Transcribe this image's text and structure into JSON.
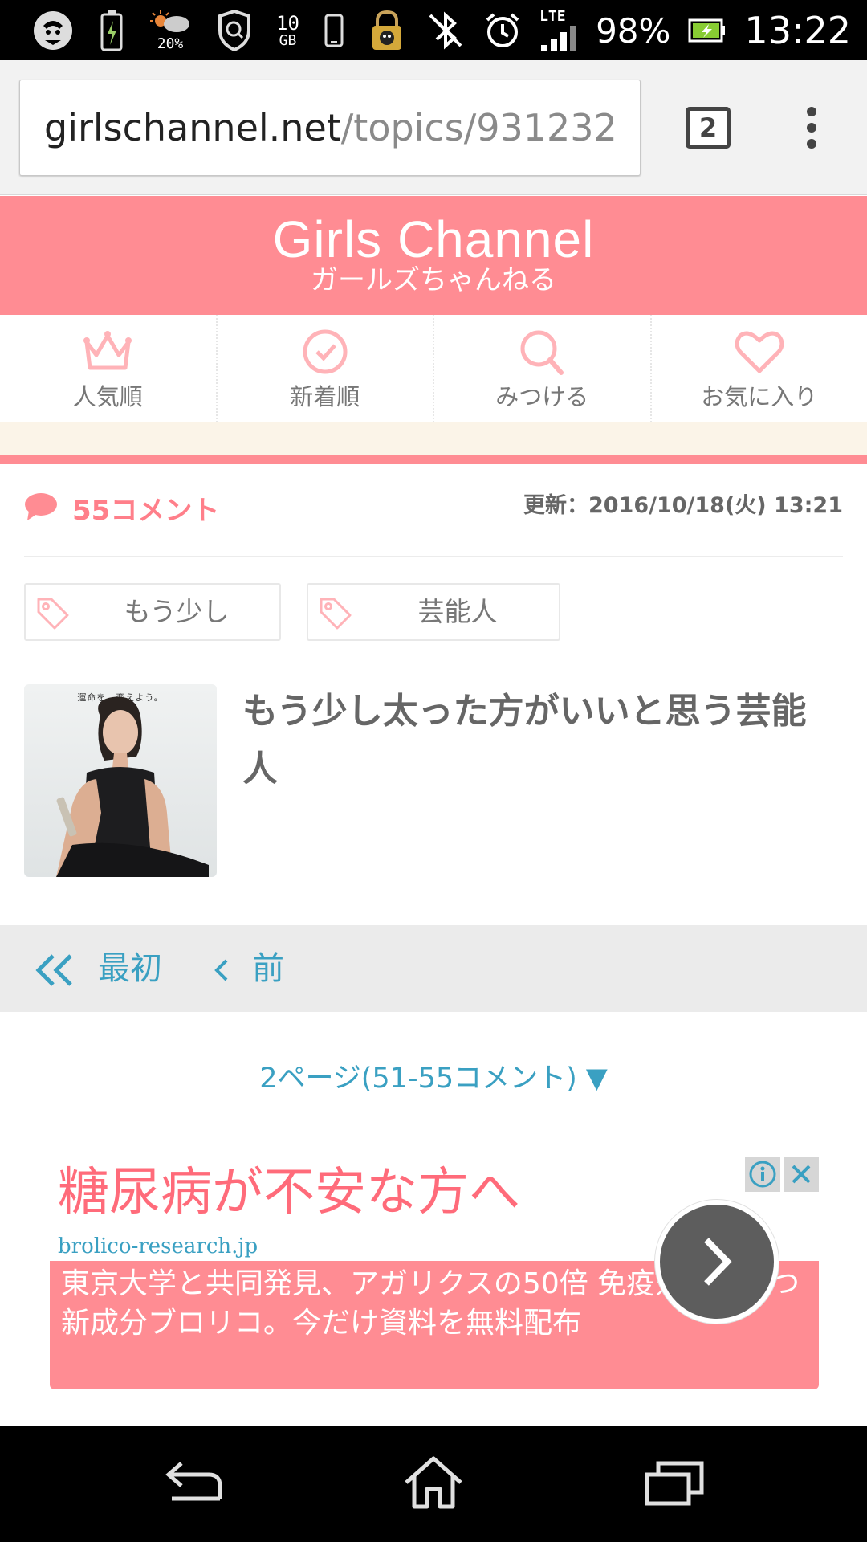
{
  "status_bar": {
    "weather_percent": "20%",
    "storage_value": "10",
    "storage_unit": "GB",
    "network": "LTE",
    "battery": "98%",
    "time": "13:22"
  },
  "browser": {
    "url_host": "girlschannel.net",
    "url_path": "/topics/931232",
    "tab_count": "2"
  },
  "site": {
    "logo_main": "Girls Channel",
    "logo_sub": "ガールズちゃんねる",
    "brand_color": "#ff8c93",
    "accent_color": "#3aa0c2"
  },
  "nav": {
    "items": [
      {
        "label": "人気順",
        "icon": "crown-icon"
      },
      {
        "label": "新着順",
        "icon": "clock-icon"
      },
      {
        "label": "みつける",
        "icon": "search-icon"
      },
      {
        "label": "お気に入り",
        "icon": "heart-icon"
      }
    ]
  },
  "topic": {
    "comment_count": "55コメント",
    "updated": "更新：2016/10/18(火) 13:21",
    "tags": [
      "もう少し",
      "芸能人"
    ],
    "thumbnail_caption": "運命を、変えよう。",
    "title": "もう少し太った方がいいと思う芸能人"
  },
  "pager": {
    "first_label": "最初",
    "prev_label": "前",
    "page_info": "2ページ(51-55コメント) ▼"
  },
  "ad": {
    "headline": "糖尿病が不安な方へ",
    "domain": "brolico-research.jp",
    "body": "東京大学と共同発見、アガリクスの50倍 免疫効果を持つ新成分ブロリコ。今だけ資料を無料配布"
  }
}
